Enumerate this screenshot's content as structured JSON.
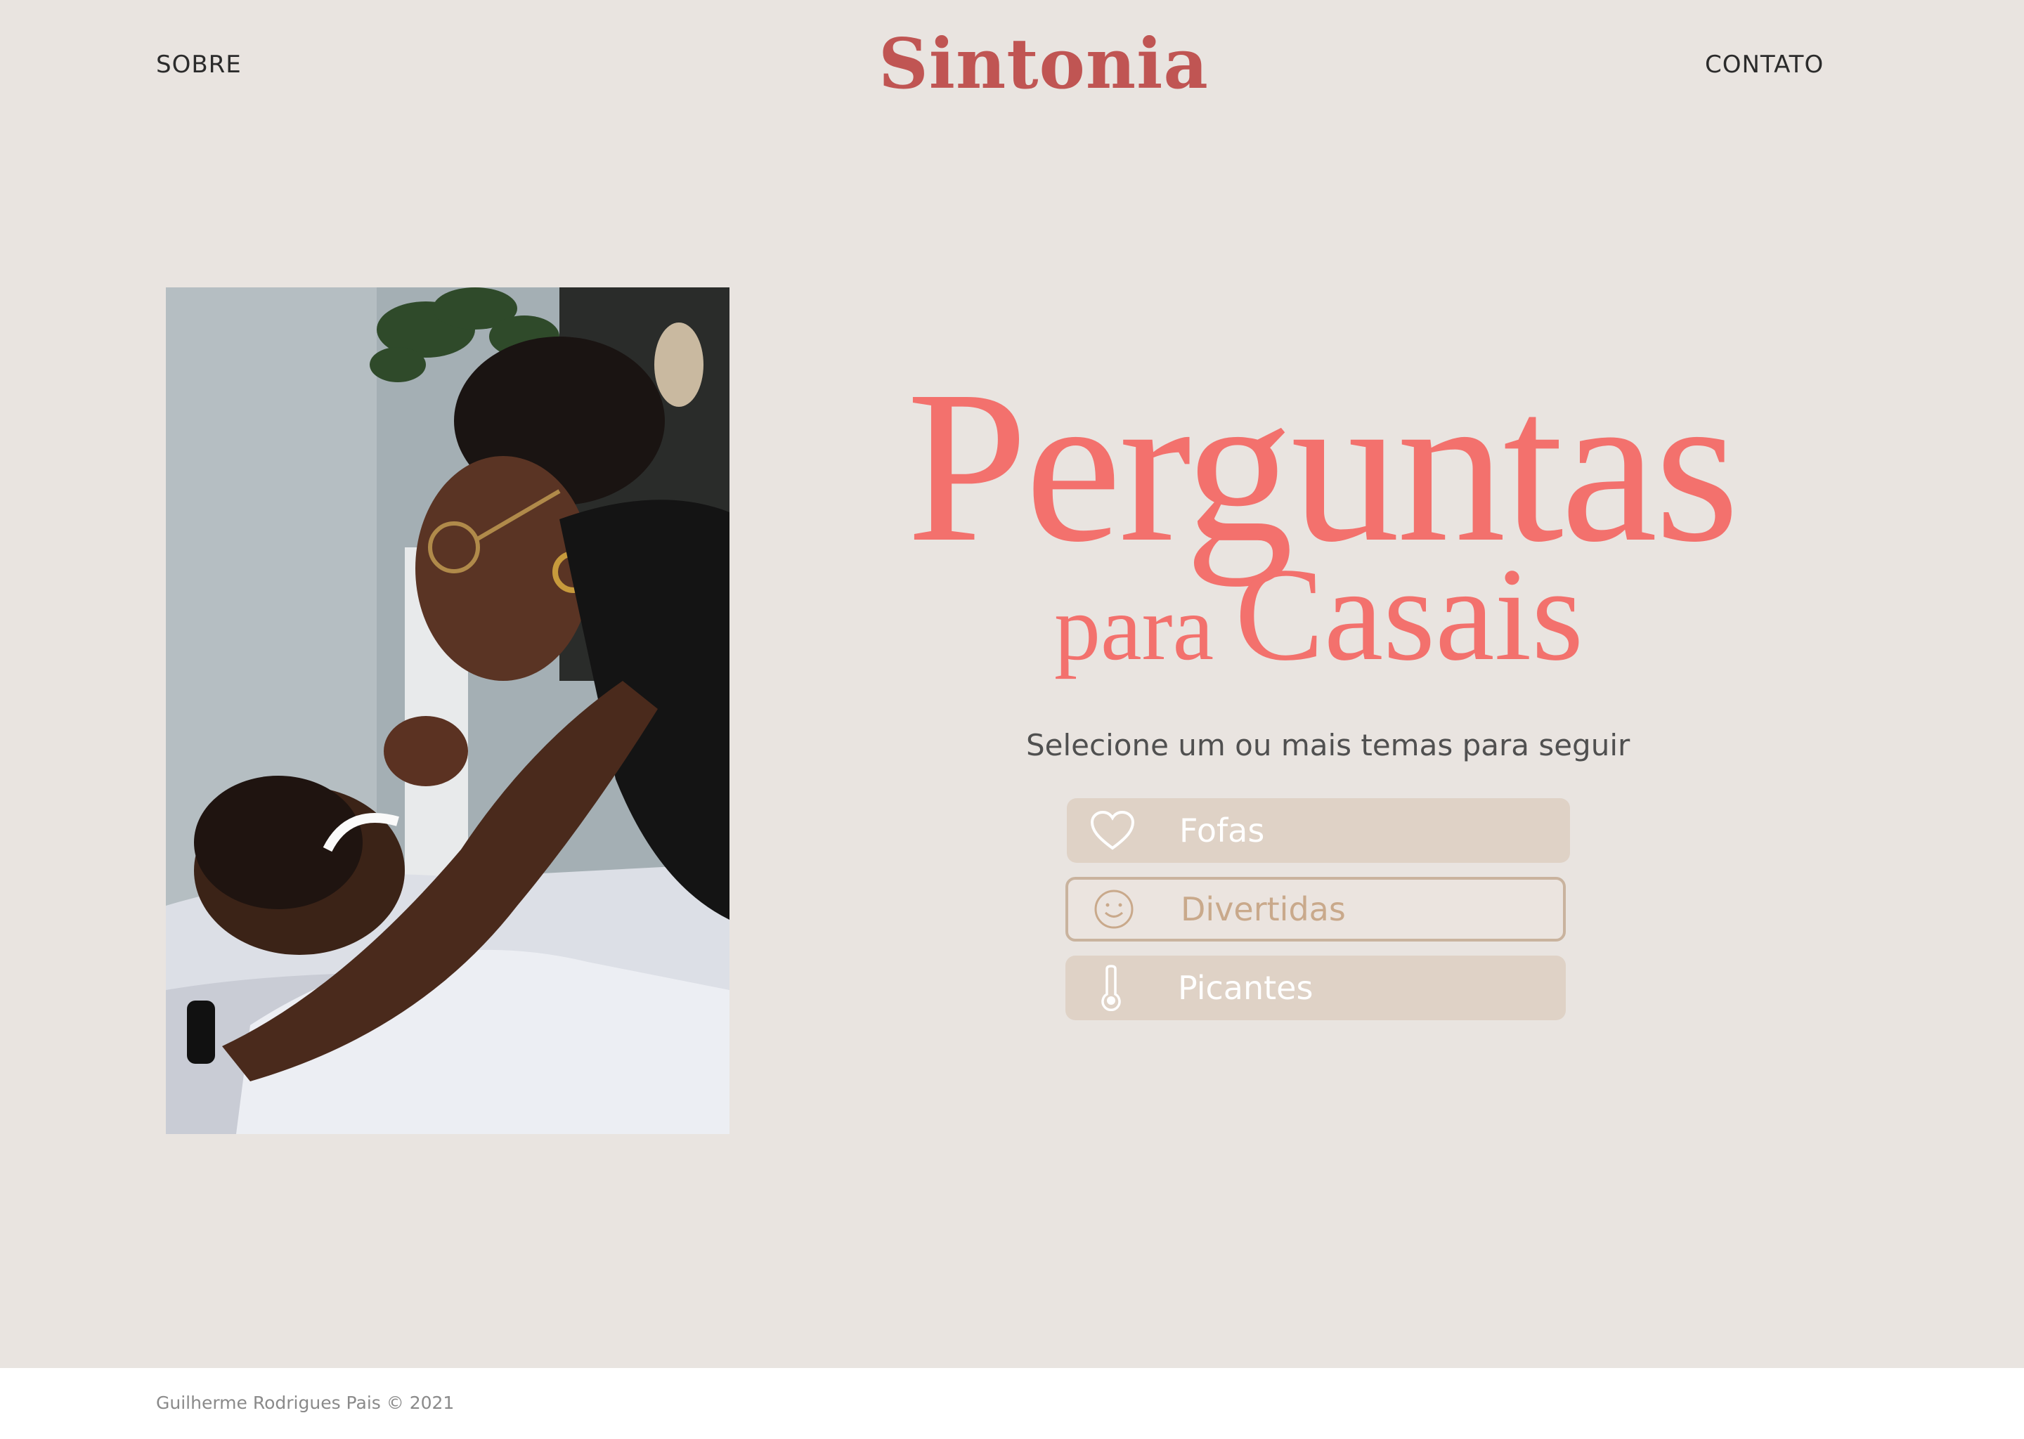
{
  "header": {
    "nav_left": "SOBRE",
    "logo": "Sintonia",
    "nav_right": "CONTATO"
  },
  "hero": {
    "title_line1": "Perguntas",
    "title_line2_small": "para",
    "title_line2_large": "Casais",
    "subtitle": "Selecione um ou mais temas para seguir",
    "options": [
      {
        "label": "Fofas",
        "icon": "heart-icon",
        "selected": true
      },
      {
        "label": "Divertidas",
        "icon": "smiley-icon",
        "selected": false
      },
      {
        "label": "Picantes",
        "icon": "thermometer-icon",
        "selected": true
      }
    ]
  },
  "footer": {
    "copyright": "Guilherme Rodrigues Pais © 2021"
  },
  "colors": {
    "background": "#e9e4e0",
    "logo": "#c05553",
    "headline": "#f3716d",
    "option_filled": "#dfd2c6",
    "option_outline": "#c9b39e"
  }
}
